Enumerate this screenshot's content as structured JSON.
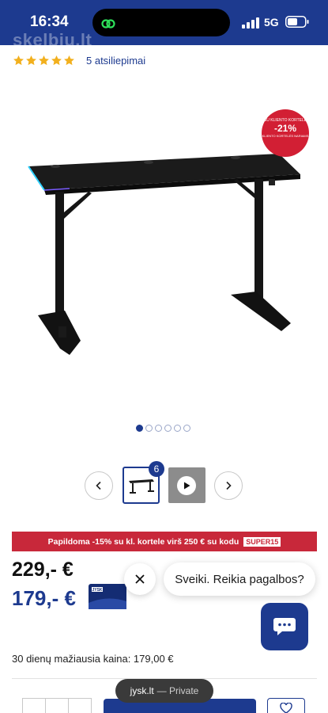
{
  "status_bar": {
    "time": "16:34",
    "network": "5G",
    "watermark": "skelbiu.lt"
  },
  "product": {
    "rating": {
      "stars": 5,
      "max_stars": 5,
      "reviews_label": "5 atsiliepimai"
    },
    "promo_badge": {
      "top_text": "SU KLIENTO KORTELE",
      "discount": "-21%",
      "note": "KLIENTO KORTELĖS NARIAMS"
    },
    "gallery": {
      "total_dots": 6,
      "active_dot": 1,
      "thumbnail_count": "6"
    },
    "promo_banner": {
      "text": "Papildoma -15% su kl. kortele virš 250 € su kodu",
      "code": "SUPER15"
    },
    "prices": {
      "old_price": "229,- €",
      "new_price": "179,- €",
      "card_label": "JYSK",
      "lowest_price": "30 dienų mažiausia kaina: 179,00 €"
    }
  },
  "chat": {
    "greeting": "Sveiki. Reikia pagalbos?"
  },
  "browser": {
    "host": "jysk.lt",
    "mode": "— Private"
  },
  "colors": {
    "brand_blue": "#1d3a8f",
    "promo_red": "#c8283a",
    "star_gold": "#f2b01e"
  }
}
